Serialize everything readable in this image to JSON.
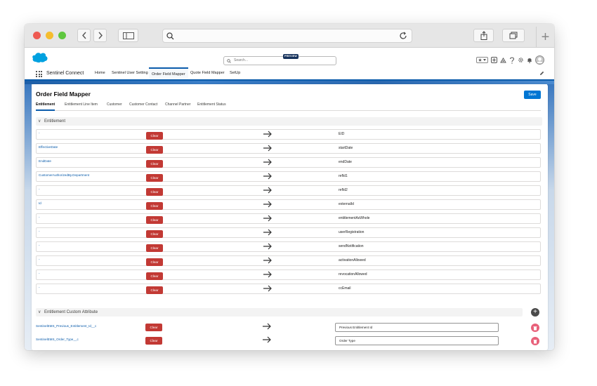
{
  "browser": {
    "icons": [
      "back-icon",
      "forward-icon",
      "sidebar-icon",
      "search-icon",
      "reload-icon",
      "share-icon",
      "tabs-icon",
      "new-tab-icon"
    ]
  },
  "header": {
    "search_placeholder": "Search...",
    "preview_badge": "PREVIEW"
  },
  "nav": {
    "app_name": "Sentinel Connect",
    "tabs": [
      {
        "label": "Home"
      },
      {
        "label": "Sentinel User Setting"
      },
      {
        "label": "Order Field Mapper",
        "active": true
      },
      {
        "label": "Quote Field Mapper"
      },
      {
        "label": "SetUp"
      }
    ]
  },
  "page": {
    "title": "Order Field Mapper",
    "save_label": "Save",
    "subtabs": [
      {
        "label": "Entitlement",
        "active": true
      },
      {
        "label": "Entitlement Line Item"
      },
      {
        "label": "Customer"
      },
      {
        "label": "Customer Contact"
      },
      {
        "label": "Channel Partner"
      },
      {
        "label": "Entitlement Status"
      }
    ],
    "clear_label": "Clear"
  },
  "entitlement_section": {
    "title": "Entitlement",
    "rows": [
      {
        "source": "-",
        "target": "EID"
      },
      {
        "source": "EffectiveDate",
        "target": "startDate"
      },
      {
        "source": "EndDate",
        "target": "endDate"
      },
      {
        "source": "CustomerAuthorizedBy.Department",
        "target": "refId1"
      },
      {
        "source": "-",
        "target": "refId2"
      },
      {
        "source": "Id",
        "target": "externalId"
      },
      {
        "source": "-",
        "target": "entitlementAsWhole"
      },
      {
        "source": "-",
        "target": "userRegistration"
      },
      {
        "source": "-",
        "target": "sendNotification"
      },
      {
        "source": "-",
        "target": "activationAllowed"
      },
      {
        "source": "-",
        "target": "revocationAllowed"
      },
      {
        "source": "-",
        "target": "ccEmail"
      }
    ]
  },
  "custom_attr_section": {
    "title": "Entitlement Custom Attribute",
    "rows": [
      {
        "source": "SentinelEMS_Previous_Entitlement_Id__c",
        "target": "Previous Entitlement Id"
      },
      {
        "source": "SentinelEMS_Order_Type__c",
        "target": "Order Type"
      }
    ]
  },
  "colors": {
    "brand": "#0176d3",
    "clear": "#c23934",
    "delete": "#e8617a",
    "link": "#0b5cab"
  }
}
